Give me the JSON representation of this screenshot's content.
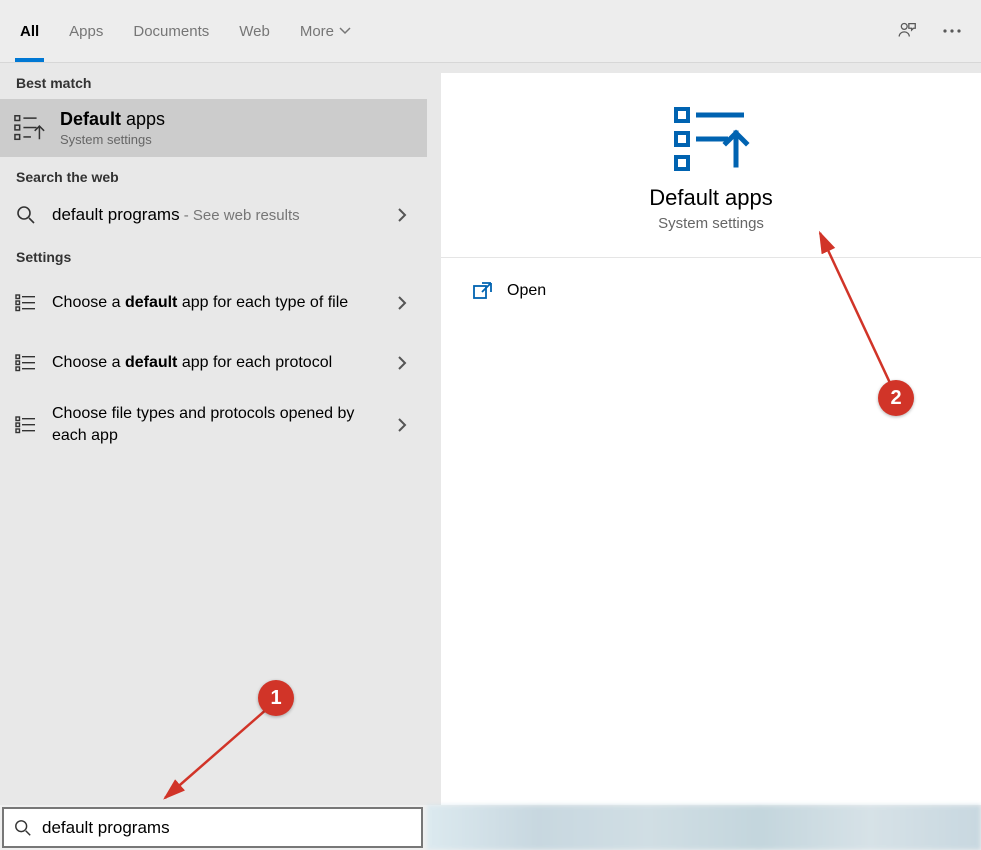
{
  "tabs": {
    "all": "All",
    "apps": "Apps",
    "documents": "Documents",
    "web": "Web",
    "more": "More"
  },
  "sections": {
    "best_match": "Best match",
    "search_web": "Search the web",
    "settings": "Settings"
  },
  "best_match": {
    "title_prefix": "Default",
    "title_rest": " apps",
    "subtitle": "System settings"
  },
  "web_result": {
    "query": "default programs",
    "suffix": " - See web results"
  },
  "settings_items": [
    {
      "pre": "Choose a ",
      "b": "default",
      "post": " app for each type of file"
    },
    {
      "pre": "Choose a ",
      "b": "default",
      "post": " app for each protocol"
    },
    {
      "pre": "",
      "b": "",
      "post": "Choose file types and protocols opened by each app"
    }
  ],
  "preview": {
    "title": "Default apps",
    "subtitle": "System settings",
    "open": "Open"
  },
  "search": {
    "value": "default programs"
  },
  "annotations": {
    "one": "1",
    "two": "2"
  }
}
